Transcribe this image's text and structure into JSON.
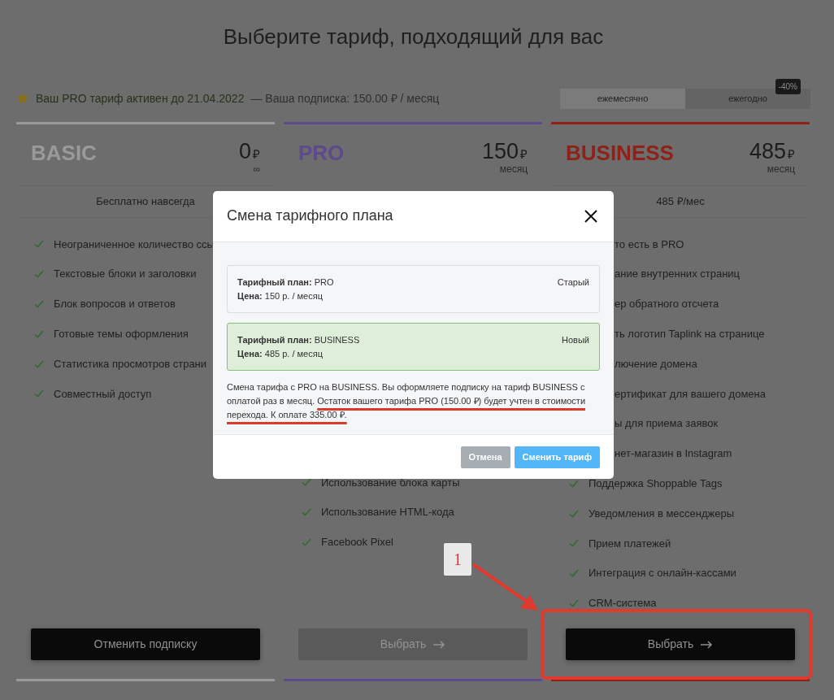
{
  "page_title": "Выберите тариф, подходящий для вас",
  "subscription": {
    "status": "Ваш PRO тариф активен до 21.04.2022",
    "detail": "— Ваша подписка: 150.00 ₽ / месяц"
  },
  "billing": [
    {
      "label": "ежемесячно",
      "selected": true
    },
    {
      "label": "ежегодно",
      "selected": false,
      "badge": "-40%"
    }
  ],
  "plans": [
    {
      "name": "BASIC",
      "color": "#9a9a9a",
      "price": "0",
      "currency": "₽",
      "period": "∞",
      "subtitle": "Бесплатно навсегда",
      "features": [
        {
          "kind": "full",
          "text": "Неограниченное количество ссы"
        },
        {
          "kind": "full",
          "text": "Текстовые блоки и заголовки"
        },
        {
          "kind": "full",
          "text": "Блок вопросов и ответов"
        },
        {
          "kind": "full",
          "text": "Готовые темы оформления"
        },
        {
          "kind": "full",
          "text": "Статистика просмотров страни"
        },
        {
          "kind": "full",
          "text": "Совместный доступ"
        }
      ],
      "button": {
        "label": "Отменить подписку",
        "disabled": false,
        "arrow": false
      }
    },
    {
      "name": "PRO",
      "color": "#5c4a8c",
      "price": "150",
      "currency": "₽",
      "period": "месяц",
      "features": [
        {
          "kind": "full",
          "text": "Использование блока карты"
        },
        {
          "kind": "full",
          "text": "Использование HTML-кода"
        },
        {
          "kind": "full",
          "text": "Facebook Pixel"
        }
      ],
      "button": {
        "label": "Выбрать",
        "disabled": true,
        "arrow": true
      }
    },
    {
      "name": "BUSINESS",
      "color": "#8e2219",
      "price": "485",
      "currency": "₽",
      "period": "месяц",
      "subtitle": "485 ₽/мес",
      "features": [
        {
          "kind": "partial",
          "text": "то есть в PRO"
        },
        {
          "kind": "partial",
          "text": "ание внутренних страниц"
        },
        {
          "kind": "partial",
          "text": "ер обратного отсчета"
        },
        {
          "kind": "partial",
          "text": "ть логотип Taplink на странице"
        },
        {
          "kind": "partial",
          "text": "лючение домена"
        },
        {
          "kind": "partial",
          "text": "ертификат для вашего домена"
        },
        {
          "kind": "partial",
          "text": "ы для приема заявок"
        },
        {
          "kind": "partial",
          "text": "нет-магазин в Instagram"
        },
        {
          "kind": "full",
          "text": "Поддержка Shoppable Tags"
        },
        {
          "kind": "full",
          "text": "Уведомления в мессенджеры"
        },
        {
          "kind": "full",
          "text": "Прием платежей"
        },
        {
          "kind": "full",
          "text": "Интеграция с онлайн-кассами"
        },
        {
          "kind": "full",
          "text": "CRM-система"
        }
      ],
      "button": {
        "label": "Выбрать",
        "disabled": false,
        "arrow": true
      }
    }
  ],
  "modal": {
    "title": "Смена тарифного плана",
    "plans": [
      {
        "kind": "old",
        "plan_label": "Тарифный план:",
        "plan": "PRO",
        "price_label": "Цена:",
        "price": "150 р. / месяц",
        "tag": "Старый"
      },
      {
        "kind": "new",
        "plan_label": "Тарифный план:",
        "plan": "BUSINESS",
        "price_label": "Цена:",
        "price": "485 р. / месяц",
        "tag": "Новый"
      }
    ],
    "note": {
      "text": "Смена тарифа с PRO на BUSINESS. Вы оформляете подписку на тариф BUSINESS с оплатой раз в месяц.",
      "underlined": "Остаток вашего тарифа PRO (150.00 ₽) будет учтен в стоимости перехода. К оплате 335.00 ₽."
    },
    "buttons": [
      {
        "kind": "secondary",
        "label": "Отмена"
      },
      {
        "kind": "primary",
        "label": "Сменить тариф"
      }
    ]
  },
  "annotation": {
    "label": "1"
  }
}
